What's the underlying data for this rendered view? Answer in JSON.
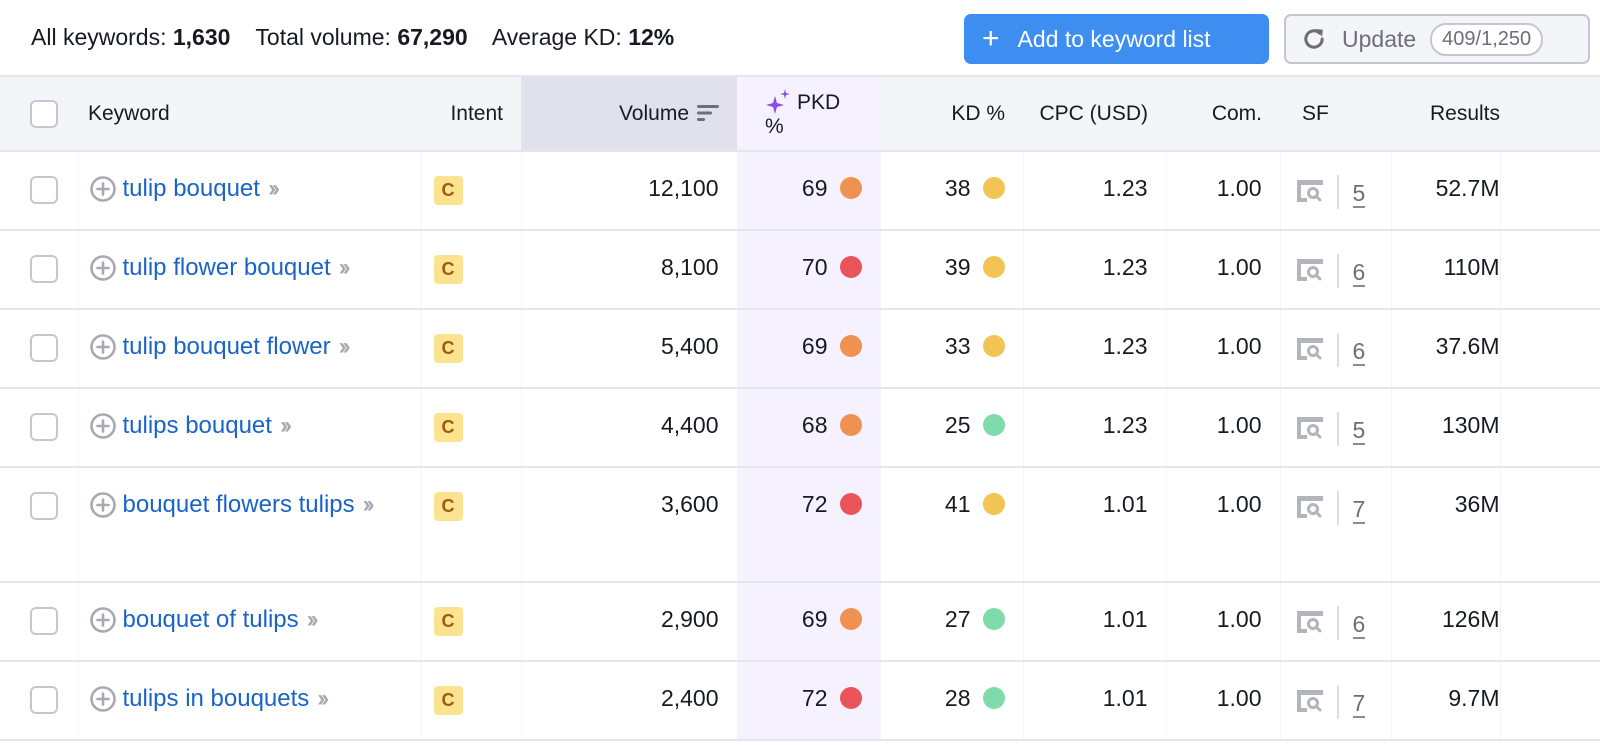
{
  "summary": {
    "all_keywords_label": "All keywords:",
    "all_keywords_value": "1,630",
    "total_volume_label": "Total volume:",
    "total_volume_value": "67,290",
    "avg_kd_label": "Average KD:",
    "avg_kd_value": "12%"
  },
  "toolbar": {
    "add_icon": "plus-icon",
    "add_label": "Add to keyword list",
    "update_icon": "refresh-icon",
    "update_label": "Update",
    "update_quota": "409/1,250"
  },
  "columns": {
    "keyword": "Keyword",
    "intent": "Intent",
    "volume": "Volume",
    "pkd": "PKD %",
    "kd": "KD %",
    "cpc": "CPC (USD)",
    "com": "Com.",
    "sf": "SF",
    "results": "Results"
  },
  "colors": {
    "accent": "#3d8ef0",
    "link": "#1a64c8",
    "dot_red": "#e9545a",
    "dot_orange": "#ef9150",
    "dot_yellow": "#f2c453",
    "dot_green": "#7fdcaa",
    "pkd_bg": "#f6f1fe"
  },
  "rows": [
    {
      "keyword": "tulip bouquet",
      "intent": "C",
      "volume": "12,100",
      "pkd": "69",
      "pkd_level": "orange",
      "kd": "38",
      "kd_level": "yellow",
      "cpc": "1.23",
      "com": "1.00",
      "sf": "5",
      "results": "52.7M"
    },
    {
      "keyword": "tulip flower bouquet",
      "intent": "C",
      "volume": "8,100",
      "pkd": "70",
      "pkd_level": "red",
      "kd": "39",
      "kd_level": "yellow",
      "cpc": "1.23",
      "com": "1.00",
      "sf": "6",
      "results": "110M"
    },
    {
      "keyword": "tulip bouquet flower",
      "intent": "C",
      "volume": "5,400",
      "pkd": "69",
      "pkd_level": "orange",
      "kd": "33",
      "kd_level": "yellow",
      "cpc": "1.23",
      "com": "1.00",
      "sf": "6",
      "results": "37.6M"
    },
    {
      "keyword": "tulips bouquet",
      "intent": "C",
      "volume": "4,400",
      "pkd": "68",
      "pkd_level": "orange",
      "kd": "25",
      "kd_level": "green",
      "cpc": "1.23",
      "com": "1.00",
      "sf": "5",
      "results": "130M"
    },
    {
      "keyword": "bouquet flowers tulips",
      "intent": "C",
      "volume": "3,600",
      "pkd": "72",
      "pkd_level": "red",
      "kd": "41",
      "kd_level": "yellow",
      "cpc": "1.01",
      "com": "1.00",
      "sf": "7",
      "results": "36M"
    },
    {
      "keyword": "bouquet of tulips",
      "intent": "C",
      "volume": "2,900",
      "pkd": "69",
      "pkd_level": "orange",
      "kd": "27",
      "kd_level": "green",
      "cpc": "1.01",
      "com": "1.00",
      "sf": "6",
      "results": "126M"
    },
    {
      "keyword": "tulips in bouquets",
      "intent": "C",
      "volume": "2,400",
      "pkd": "72",
      "pkd_level": "red",
      "kd": "28",
      "kd_level": "green",
      "cpc": "1.01",
      "com": "1.00",
      "sf": "7",
      "results": "9.7M"
    }
  ]
}
